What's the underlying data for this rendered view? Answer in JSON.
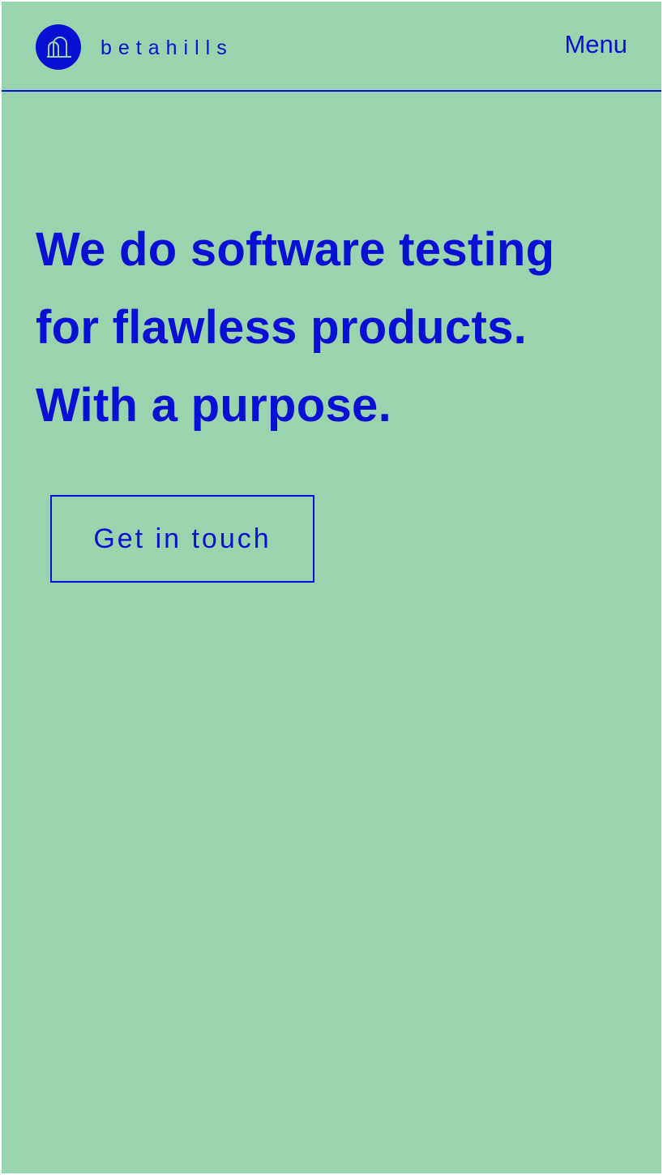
{
  "header": {
    "brand_name": "betahills",
    "logo_icon": "hill-arch-logo-icon",
    "menu_label": "Menu"
  },
  "hero": {
    "title_lines": [
      "We do software testing",
      "for flawless products.",
      "With a purpose."
    ],
    "cta_label": "Get in touch"
  },
  "colors": {
    "background": "#98d4ad",
    "accent": "#0a10d3"
  }
}
